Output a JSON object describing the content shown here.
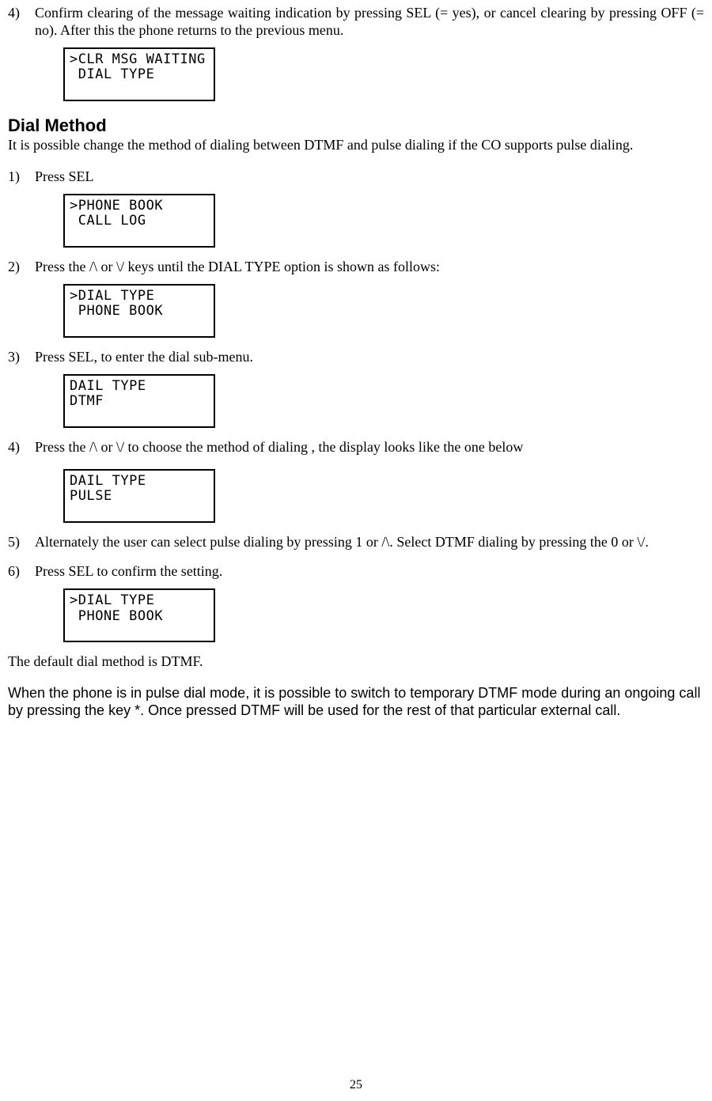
{
  "first_item": {
    "num": "4)",
    "text": "Confirm clearing of the message waiting indication by pressing SEL (= yes), or cancel clearing by pressing OFF (= no). After this the phone returns to the previous menu."
  },
  "lcd1": ">CLR MSG WAITING\n DIAL TYPE",
  "section_title": "Dial Method",
  "intro": "It is possible change the method of dialing between DTMF and pulse dialing if the CO supports pulse dialing.",
  "steps": [
    {
      "num": "1)",
      "text": "Press SEL",
      "lcd": ">PHONE BOOK\n CALL LOG"
    },
    {
      "num": "2)",
      "text": "Press the /\\ or \\/ keys until the DIAL TYPE option is shown as follows:",
      "lcd": ">DIAL TYPE\n PHONE BOOK"
    },
    {
      "num": "3)",
      "text": "Press SEL, to enter the dial sub-menu.",
      "lcd": "DAIL TYPE\nDTMF"
    },
    {
      "num": "4)",
      "text": "Press the /\\ or \\/ to choose the method of dialing , the display looks like the one below",
      "lcd": "DAIL TYPE\nPULSE"
    },
    {
      "num": "5)",
      "text": "Alternately the user can select pulse dialing by pressing 1 or /\\. Select DTMF dialing by pressing the 0 or \\/."
    },
    {
      "num": "6)",
      "text": "Press SEL to confirm the setting.",
      "lcd": ">DIAL TYPE\n PHONE BOOK"
    }
  ],
  "default_note": "The default dial method is DTMF.",
  "note": "When the phone is in pulse dial mode, it is possible to switch to temporary DTMF mode during an ongoing call by pressing the key *.  Once pressed DTMF will be used for the rest of that particular external call.",
  "page_number": "25"
}
